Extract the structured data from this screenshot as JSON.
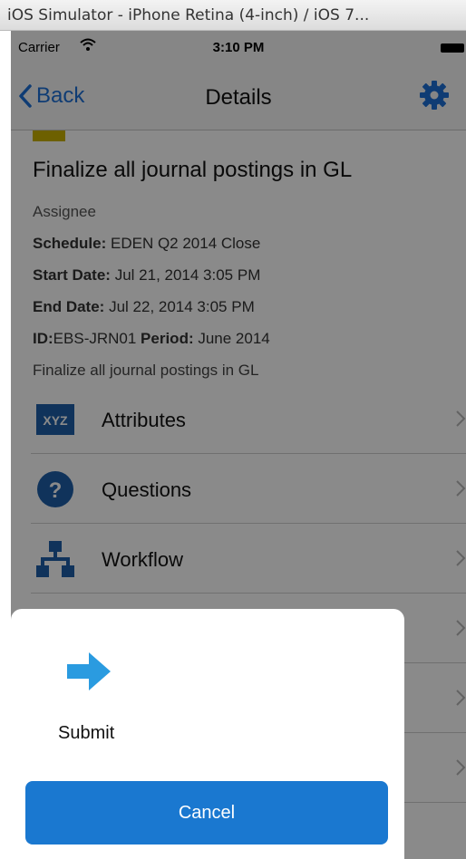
{
  "window": {
    "title": "iOS Simulator - iPhone Retina (4-inch) / iOS 7..."
  },
  "status_bar": {
    "carrier": "Carrier",
    "time": "3:10 PM"
  },
  "nav": {
    "back_label": "Back",
    "title": "Details"
  },
  "task": {
    "title": "Finalize all journal postings in GL",
    "assignee_label": "Assignee",
    "schedule_label": "Schedule:",
    "schedule_value": "EDEN Q2 2014 Close",
    "start_label": "Start Date:",
    "start_value": "Jul 21, 2014 3:05 PM",
    "end_label": "End Date:",
    "end_value": "Jul 22, 2014 3:05 PM",
    "id_label": "ID:",
    "id_value": "EBS-JRN01",
    "period_label": "Period:",
    "period_value": "June 2014",
    "description": "Finalize all journal postings in GL"
  },
  "list": {
    "items": [
      {
        "label": "Attributes",
        "icon": "xyz-icon",
        "icon_text": "XYZ"
      },
      {
        "label": "Questions",
        "icon": "question-icon",
        "icon_text": "?"
      },
      {
        "label": "Workflow",
        "icon": "workflow-icon"
      },
      {
        "label": "",
        "icon": "document-icon"
      },
      {
        "label": ""
      },
      {
        "label": ""
      }
    ]
  },
  "action_sheet": {
    "submit_label": "Submit",
    "cancel_label": "Cancel"
  },
  "colors": {
    "accent": "#1a78d0",
    "tab_yellow": "#c9b100",
    "icon_blue": "#1f5fa8",
    "arrow_blue": "#2a9be0"
  }
}
